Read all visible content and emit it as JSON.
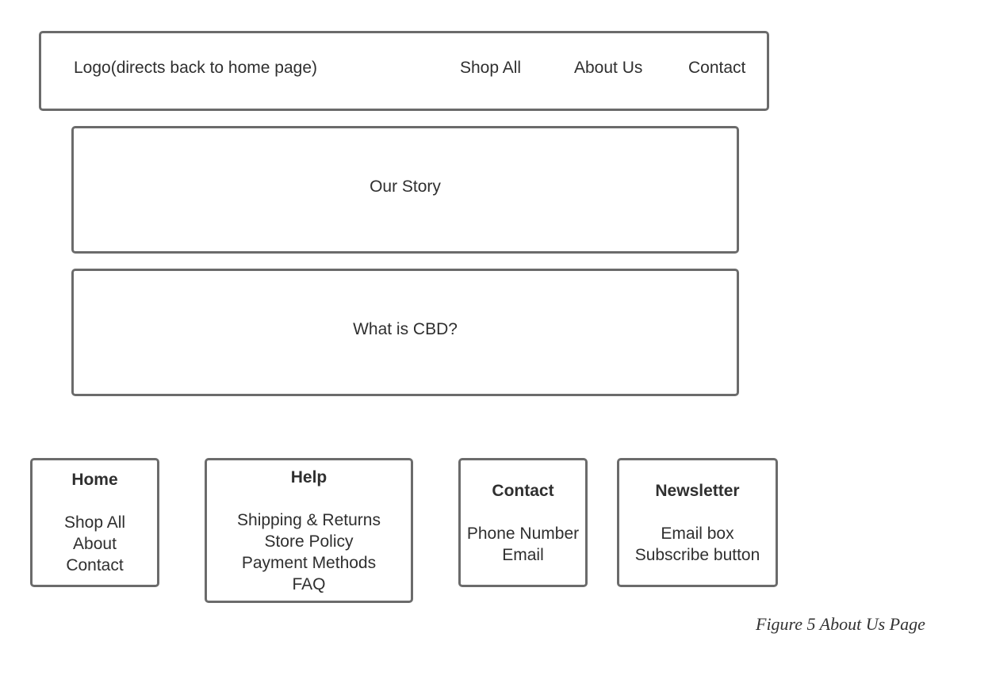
{
  "header": {
    "logo_label": "Logo(directs back to home page)",
    "nav": {
      "shop_all": "Shop All",
      "about_us": "About Us",
      "contact": "Contact"
    }
  },
  "sections": {
    "our_story": "Our Story",
    "what_is_cbd": "What is CBD?"
  },
  "footer": {
    "home": {
      "title": "Home",
      "links": [
        "Shop All",
        "About",
        "Contact"
      ]
    },
    "help": {
      "title": "Help",
      "links": [
        "Shipping & Returns",
        "Store Policy",
        "Payment Methods",
        "FAQ"
      ]
    },
    "contact": {
      "title": "Contact",
      "links": [
        "Phone Number",
        "Email"
      ]
    },
    "newsletter": {
      "title": "Newsletter",
      "links": [
        "Email box",
        "Subscribe button"
      ]
    }
  },
  "caption": "Figure 5 About Us Page",
  "colors": {
    "border": "#6b6b6b",
    "text": "#2f2f2f",
    "background": "#ffffff"
  }
}
